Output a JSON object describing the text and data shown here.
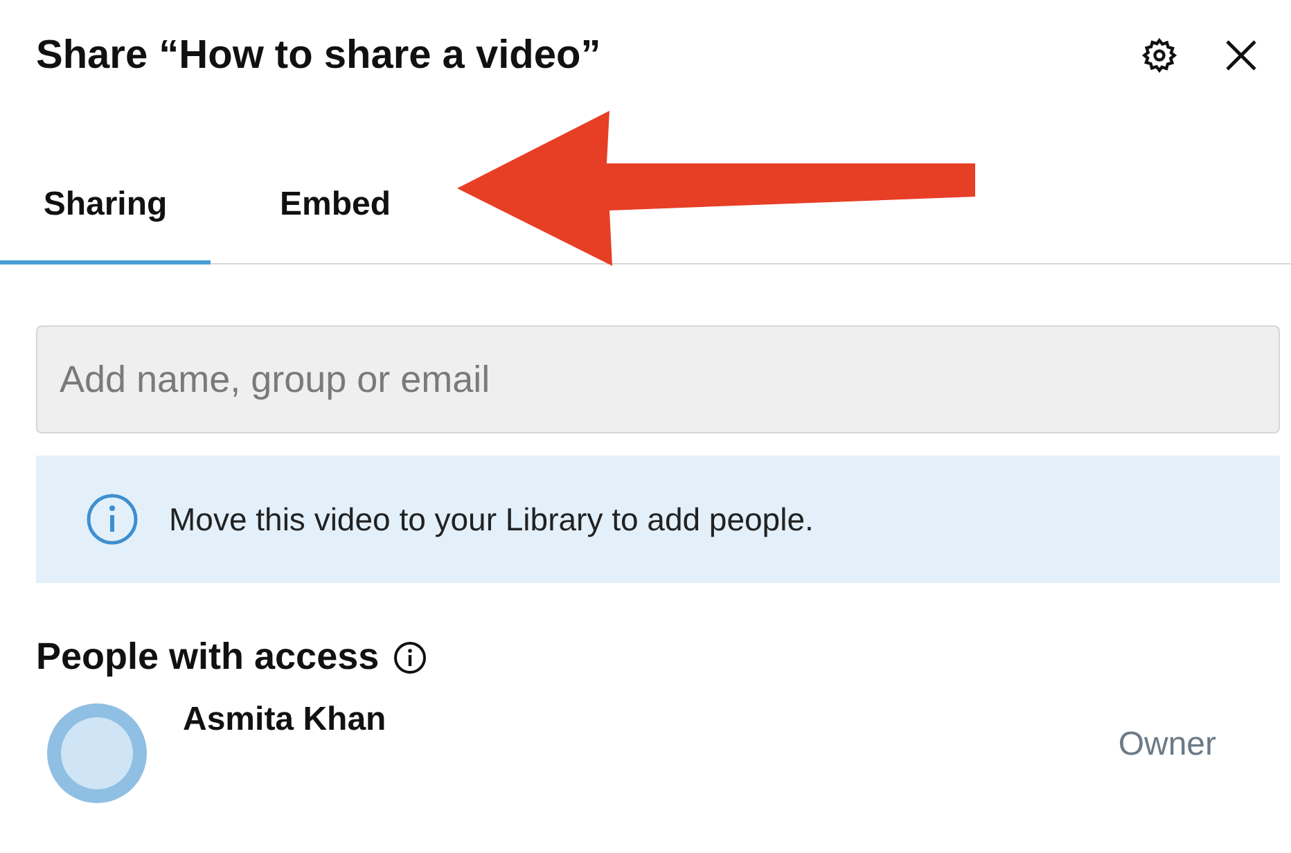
{
  "dialog": {
    "title": "Share “How to share a video”"
  },
  "tabs": [
    {
      "label": "Sharing",
      "selected": true
    },
    {
      "label": "Embed",
      "selected": false
    }
  ],
  "search": {
    "placeholder": "Add name, group or email"
  },
  "notice": {
    "text": "Move this video to your Library to add people."
  },
  "people": {
    "heading": "People with access",
    "items": [
      {
        "name": "Asmita Khan",
        "role": "Owner"
      }
    ]
  }
}
